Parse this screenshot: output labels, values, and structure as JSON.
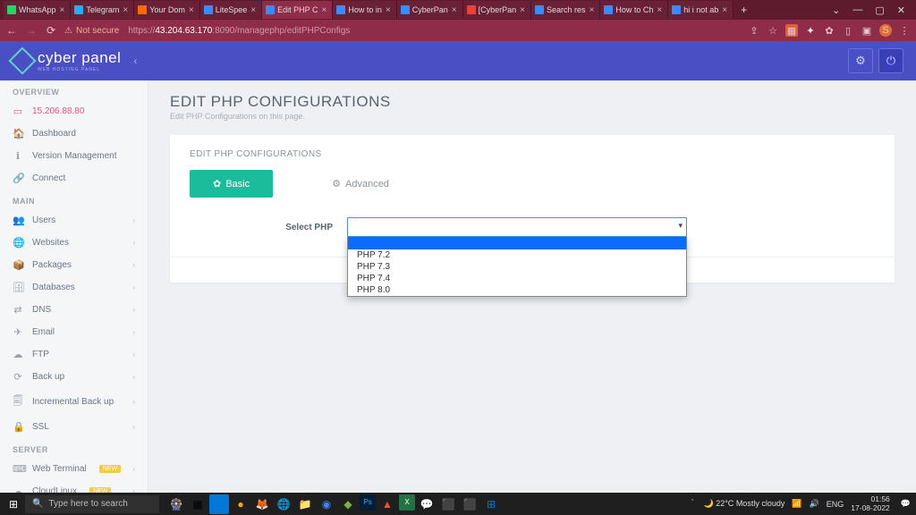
{
  "browser": {
    "tabs": [
      {
        "label": "WhatsApp",
        "icon_bg": "#25d366"
      },
      {
        "label": "Telegram",
        "icon_bg": "#2aabee"
      },
      {
        "label": "Your Dom",
        "icon_bg": "#ff6a00"
      },
      {
        "label": "LiteSpee",
        "icon_bg": "#3a8bff"
      },
      {
        "label": "Edit PHP C",
        "icon_bg": "#3a8bff",
        "active": true
      },
      {
        "label": "How to in",
        "icon_bg": "#3a8bff"
      },
      {
        "label": "CyberPan",
        "icon_bg": "#3a8bff"
      },
      {
        "label": "[CyberPan",
        "icon_bg": "#ea4335"
      },
      {
        "label": "Search res",
        "icon_bg": "#3a8bff"
      },
      {
        "label": "How to Ch",
        "icon_bg": "#3a8bff"
      },
      {
        "label": "hi i not ab",
        "icon_bg": "#3a8bff"
      }
    ],
    "insecure_label": "Not secure",
    "url_prefix": "https://",
    "url_host": "43.204.63.170",
    "url_path": ":8090/managephp/editPHPConfigs"
  },
  "appheader": {
    "brand": "cyber panel",
    "tagline": "WEB HOSTING PANEL"
  },
  "sidebar": {
    "sections": [
      {
        "heading": "OVERVIEW",
        "items": [
          {
            "label": "15.206.88.80",
            "icon": "▭",
            "accent": true
          },
          {
            "label": "Dashboard",
            "icon": "🏠"
          },
          {
            "label": "Version Management",
            "icon": "ℹ"
          },
          {
            "label": "Connect",
            "icon": "🔗"
          }
        ]
      },
      {
        "heading": "MAIN",
        "items": [
          {
            "label": "Users",
            "icon": "👥",
            "expandable": true
          },
          {
            "label": "Websites",
            "icon": "🌐",
            "expandable": true
          },
          {
            "label": "Packages",
            "icon": "📦",
            "expandable": true
          },
          {
            "label": "Databases",
            "icon": "🗄",
            "expandable": true
          },
          {
            "label": "DNS",
            "icon": "⇄",
            "expandable": true
          },
          {
            "label": "Email",
            "icon": "✈",
            "expandable": true
          },
          {
            "label": "FTP",
            "icon": "☁",
            "expandable": true
          },
          {
            "label": "Back up",
            "icon": "⟳",
            "expandable": true
          },
          {
            "label": "Incremental Back up",
            "icon": "🗐",
            "expandable": true
          },
          {
            "label": "SSL",
            "icon": "🔒",
            "expandable": true
          }
        ]
      },
      {
        "heading": "SERVER",
        "items": [
          {
            "label": "Web Terminal",
            "icon": "⌨",
            "badge": "NEW",
            "expandable": true
          },
          {
            "label": "CloudLinux",
            "icon": "☁",
            "badge": "NEW",
            "expandable": true
          }
        ]
      }
    ]
  },
  "page": {
    "title": "EDIT PHP CONFIGURATIONS",
    "subtitle": "Edit PHP Configurations on this page.",
    "card_title": "EDIT PHP CONFIGURATIONS",
    "tab_basic": "Basic",
    "tab_advanced": "Advanced",
    "select_label": "Select PHP",
    "select_value": "",
    "options": [
      "",
      "PHP 7.2",
      "PHP 7.3",
      "PHP 7.4",
      "PHP 8.0"
    ]
  },
  "taskbar": {
    "search_placeholder": "Type here to search",
    "weather_temp": "22°C",
    "weather_desc": "Mostly cloudy",
    "lang": "ENG",
    "time": "01:56",
    "date": "17-08-2022"
  }
}
